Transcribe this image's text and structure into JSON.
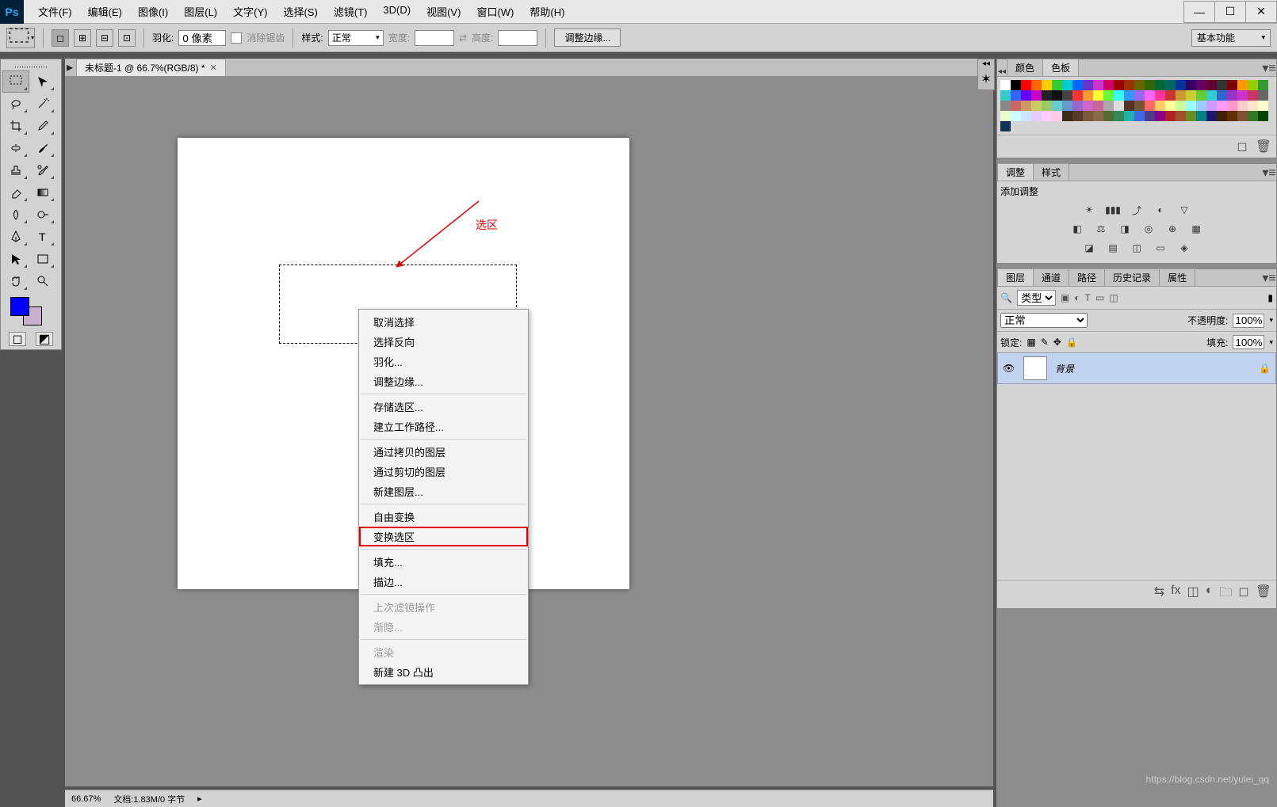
{
  "menubar": {
    "items": [
      "文件(F)",
      "编辑(E)",
      "图像(I)",
      "图层(L)",
      "文字(Y)",
      "选择(S)",
      "滤镜(T)",
      "3D(D)",
      "视图(V)",
      "窗口(W)",
      "帮助(H)"
    ]
  },
  "optionsbar": {
    "feather_label": "羽化:",
    "feather_value": "0 像素",
    "antialias_label": "消除锯齿",
    "style_label": "样式:",
    "style_value": "正常",
    "width_label": "宽度:",
    "height_label": "高度:",
    "refine_edge": "调整边缘...",
    "workspace": "基本功能"
  },
  "document": {
    "tab_title": "未标题-1 @ 66.7%(RGB/8) *"
  },
  "annotation": {
    "selection_label": "选区"
  },
  "context_menu": {
    "items": [
      {
        "label": "取消选择",
        "type": "item"
      },
      {
        "label": "选择反向",
        "type": "item"
      },
      {
        "label": "羽化...",
        "type": "item"
      },
      {
        "label": "调整边缘...",
        "type": "item"
      },
      {
        "type": "sep"
      },
      {
        "label": "存储选区...",
        "type": "item"
      },
      {
        "label": "建立工作路径...",
        "type": "item"
      },
      {
        "type": "sep"
      },
      {
        "label": "通过拷贝的图层",
        "type": "item"
      },
      {
        "label": "通过剪切的图层",
        "type": "item"
      },
      {
        "label": "新建图层...",
        "type": "item"
      },
      {
        "type": "sep"
      },
      {
        "label": "自由变换",
        "type": "item"
      },
      {
        "label": "变换选区",
        "type": "item",
        "highlight": true
      },
      {
        "type": "sep"
      },
      {
        "label": "填充...",
        "type": "item"
      },
      {
        "label": "描边...",
        "type": "item"
      },
      {
        "type": "sep"
      },
      {
        "label": "上次滤镜操作",
        "type": "item",
        "disabled": true
      },
      {
        "label": "渐隐...",
        "type": "item",
        "disabled": true
      },
      {
        "type": "sep"
      },
      {
        "label": "渲染",
        "type": "item",
        "disabled": true
      },
      {
        "label": "新建 3D 凸出",
        "type": "item"
      }
    ]
  },
  "statusbar": {
    "zoom": "66.67%",
    "doc_info": "文档:1.83M/0 字节"
  },
  "panels": {
    "color_tabs": [
      "颜色",
      "色板"
    ],
    "adjust_tabs": [
      "调整",
      "样式"
    ],
    "adjust_label": "添加调整",
    "layers_tabs": [
      "图层",
      "通道",
      "路径",
      "历史记录",
      "属性"
    ],
    "blend_mode": "正常",
    "filter_kind": "类型",
    "opacity_label": "不透明度:",
    "opacity_value": "100%",
    "lock_label": "锁定:",
    "fill_label": "填充:",
    "fill_value": "100%",
    "layer_name": "背景"
  },
  "watermark": "https://blog.csdn.net/yulei_qq",
  "swatch_colors": [
    "#ffffff",
    "#000000",
    "#ff0000",
    "#ff6600",
    "#ffcc00",
    "#33cc33",
    "#00cccc",
    "#0066ff",
    "#6633cc",
    "#cc33cc",
    "#cc0066",
    "#990000",
    "#993300",
    "#666600",
    "#336600",
    "#006633",
    "#006666",
    "#003399",
    "#330066",
    "#660066",
    "#660033",
    "#333333",
    "#800000",
    "#ff9900",
    "#99cc00",
    "#339933",
    "#33cccc",
    "#3366ff",
    "#6600ff",
    "#cc00cc",
    "#222222",
    "#111111",
    "#444444",
    "#ff3333",
    "#ff9933",
    "#ffff33",
    "#66ff33",
    "#33ffff",
    "#3399ff",
    "#9966ff",
    "#ff66ff",
    "#ff3399",
    "#cc3333",
    "#cc9933",
    "#cccc33",
    "#66cc33",
    "#33cccc",
    "#3366cc",
    "#9933cc",
    "#cc33cc",
    "#cc3366",
    "#666666",
    "#888888",
    "#cc6666",
    "#cc9966",
    "#cccc66",
    "#99cc66",
    "#66cccc",
    "#6699cc",
    "#9966cc",
    "#cc66cc",
    "#cc6699",
    "#aaaaaa",
    "#dddddd",
    "#553322",
    "#775533",
    "#ff6666",
    "#ffcc66",
    "#ffff99",
    "#ccff99",
    "#99ffff",
    "#99ccff",
    "#cc99ff",
    "#ff99ff",
    "#ff99cc",
    "#ffcccc",
    "#ffe6cc",
    "#ffffcc",
    "#e6ffcc",
    "#ccffff",
    "#cce6ff",
    "#e6ccff",
    "#ffccff",
    "#ffcce6",
    "#3a2a1a",
    "#5a3a2a",
    "#7a5a3a",
    "#8a6a4a",
    "#556b2f",
    "#2e8b57",
    "#20b2aa",
    "#4169e1",
    "#483d8b",
    "#8b008b",
    "#b22222",
    "#a0522d",
    "#6b8e23",
    "#008080",
    "#191970",
    "#402000",
    "#603000",
    "#805030",
    "#337722",
    "#004400",
    "#113355"
  ]
}
